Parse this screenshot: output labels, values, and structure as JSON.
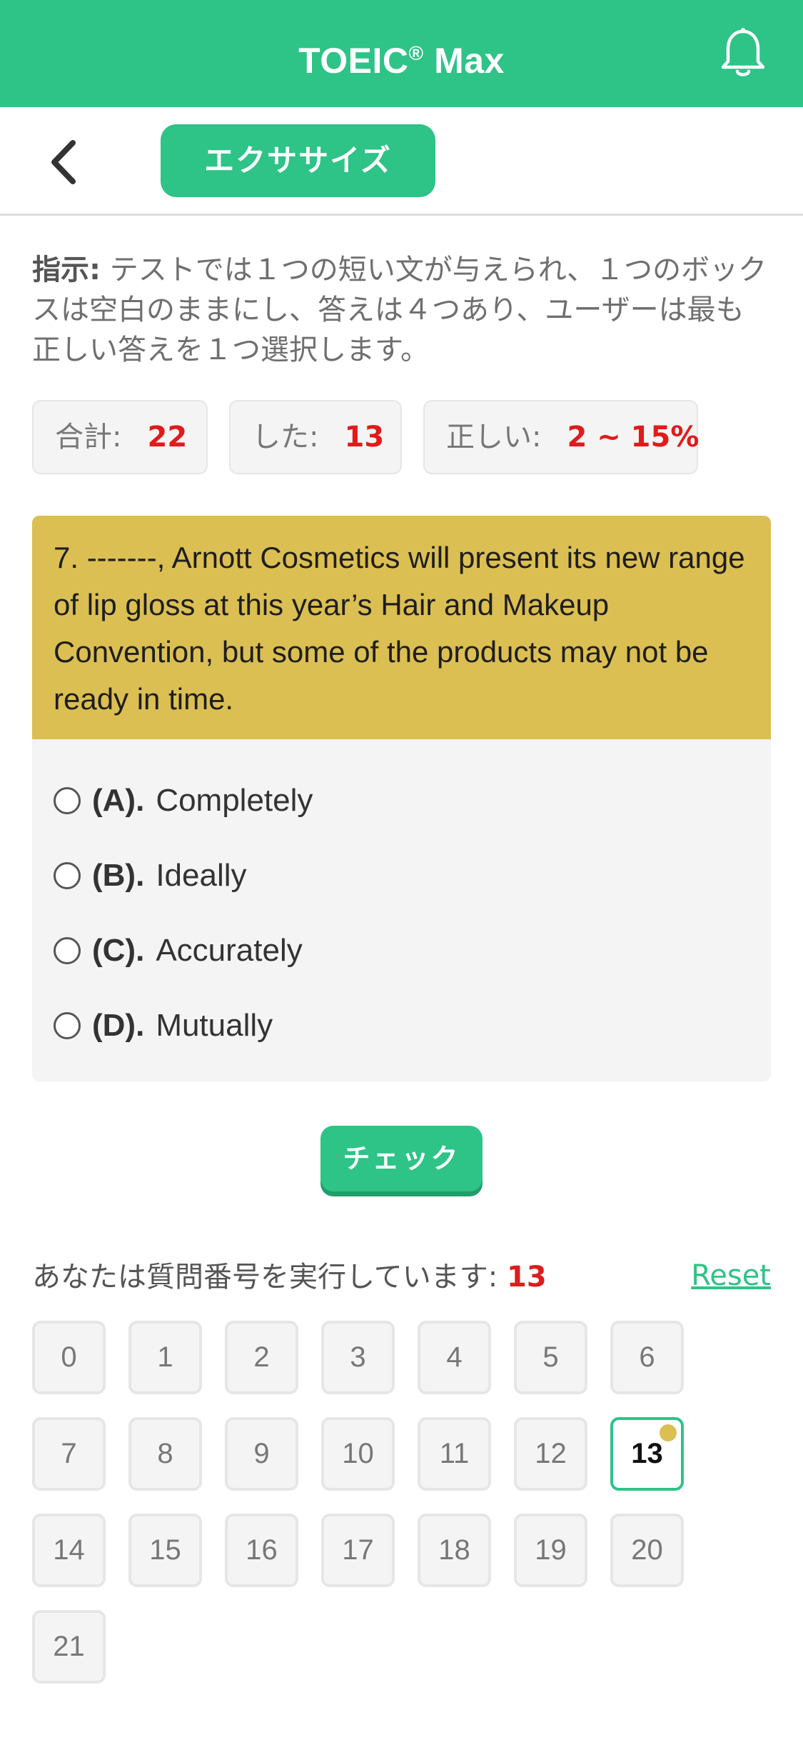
{
  "app": {
    "title": "TOEIC",
    "title_mark": "®",
    "title_suffix": " Max"
  },
  "subbar": {
    "tab_label": "エクササイズ"
  },
  "instructions": {
    "label": "指示:",
    "text": " テストでは１つの短い文が与えられ、１つのボックスは空白のままにし、答えは４つあり、ユーザーは最も正しい答えを１つ選択します。"
  },
  "stats": {
    "total_label": "合計:",
    "total_value": "22",
    "done_label": "した:",
    "done_value": "13",
    "correct_label": "正しい:",
    "correct_value": "2 ~ 15%"
  },
  "question": {
    "text": "7. -------, Arnott Cosmetics will present its new range of lip gloss at this year’s Hair and Makeup Convention, but some of the products may not be ready in time.",
    "options": [
      {
        "letter": "(A).",
        "text": "Completely"
      },
      {
        "letter": "(B).",
        "text": "Ideally"
      },
      {
        "letter": "(C).",
        "text": "Accurately"
      },
      {
        "letter": "(D).",
        "text": "Mutually"
      }
    ]
  },
  "check_button": "チェック",
  "progress": {
    "label": "あなたは質問番号を実行しています:",
    "current": "13",
    "reset": "Reset"
  },
  "question_grid": [
    "0",
    "1",
    "2",
    "3",
    "4",
    "5",
    "6",
    "7",
    "8",
    "9",
    "10",
    "11",
    "12",
    "13",
    "14",
    "15",
    "16",
    "17",
    "18",
    "19",
    "20",
    "21"
  ],
  "colors": {
    "primary": "#2ec387",
    "question_header": "#dbbf52",
    "highlight_red": "#e01b1b"
  },
  "icons": {
    "bell": "bell-icon",
    "back": "chevron-left-icon"
  }
}
